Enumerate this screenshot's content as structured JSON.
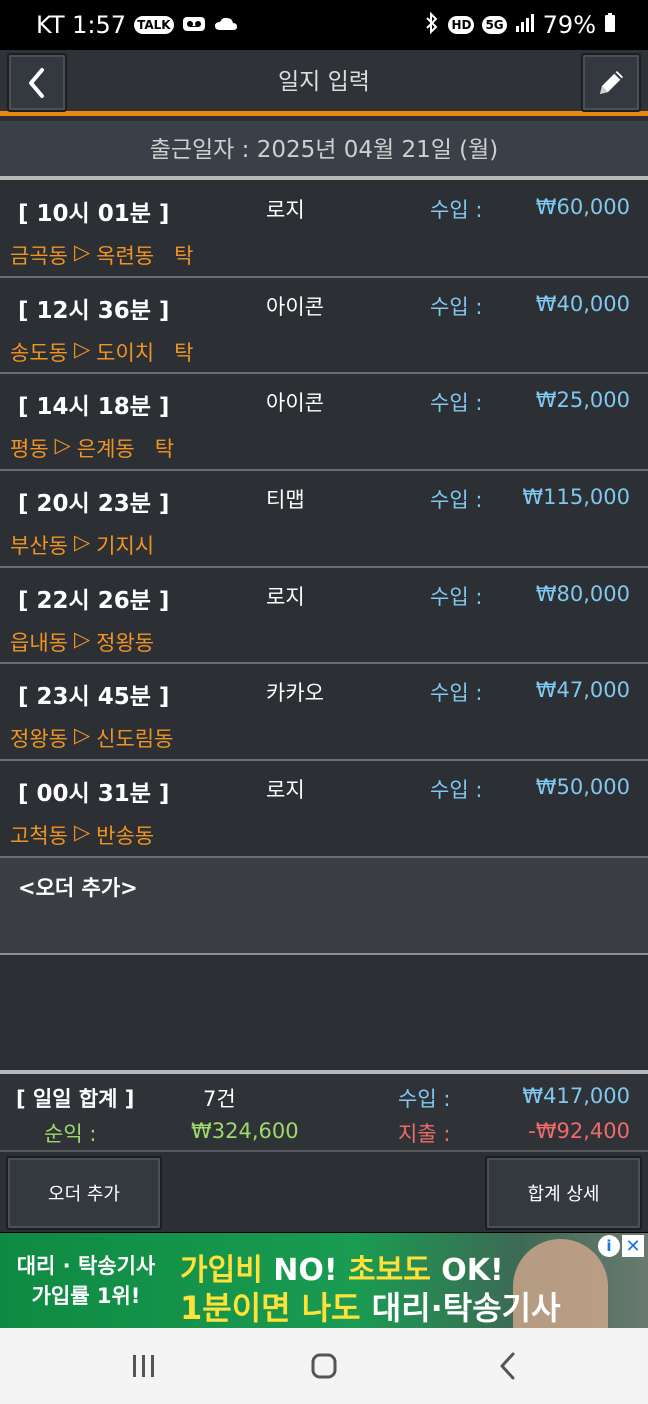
{
  "status_bar": {
    "carrier_time": "KT 1:57",
    "talk_badge": "TALK",
    "hd_badge": "HD",
    "net_badge": "5G",
    "battery": "79%"
  },
  "header": {
    "title": "일지 입력"
  },
  "date_bar": {
    "text": "출근일자 : 2025년 04월 21일 (월)"
  },
  "orders": [
    {
      "time": "[ 10시 01분 ]",
      "company": "로지",
      "income_label": "수입 :",
      "amount": "₩60,000",
      "from": "금곡동",
      "to": "옥련동",
      "tag": "탁"
    },
    {
      "time": "[ 12시 36분 ]",
      "company": "아이콘",
      "income_label": "수입 :",
      "amount": "₩40,000",
      "from": "송도동",
      "to": "도이치",
      "tag": "탁"
    },
    {
      "time": "[ 14시 18분 ]",
      "company": "아이콘",
      "income_label": "수입 :",
      "amount": "₩25,000",
      "from": "평동",
      "to": "은계동",
      "tag": "탁"
    },
    {
      "time": "[ 20시 23분 ]",
      "company": "티맵",
      "income_label": "수입 :",
      "amount": "₩115,000",
      "from": "부산동",
      "to": "기지시",
      "tag": ""
    },
    {
      "time": "[ 22시 26분 ]",
      "company": "로지",
      "income_label": "수입 :",
      "amount": "₩80,000",
      "from": "읍내동",
      "to": "정왕동",
      "tag": ""
    },
    {
      "time": "[ 23시 45분 ]",
      "company": "카카오",
      "income_label": "수입 :",
      "amount": "₩47,000",
      "from": "정왕동",
      "to": "신도림동",
      "tag": ""
    },
    {
      "time": "[ 00시 31분 ]",
      "company": "로지",
      "income_label": "수입 :",
      "amount": "₩50,000",
      "from": "고척동",
      "to": "반송동",
      "tag": ""
    }
  ],
  "route_arrow": "▷",
  "add_order_row": "<오더 추가>",
  "summary": {
    "title": "[ 일일 합계 ]",
    "count": "7건",
    "income_label": "수입 :",
    "income_value": "₩417,000",
    "net_label": "순익 :",
    "net_value": "₩324,600",
    "expense_label": "지출 :",
    "expense_value": "-₩92,400"
  },
  "buttons": {
    "add_order": "오더 추가",
    "total_detail": "합계 상세"
  },
  "ad": {
    "left_line1": "대리 · 탁송기사",
    "left_line2": "가입률 1위!",
    "line1_a": "가입비 ",
    "line1_b": "NO! ",
    "line1_c": "초보도 ",
    "line1_d": "OK!",
    "line2_a": "1분이면 나도 ",
    "line2_b": "대리·탁송기사",
    "info": "i",
    "close": "✕"
  },
  "colors": {
    "accent_orange": "#e88a12",
    "route_orange": "#ef9422",
    "income_blue": "#7fc8f0",
    "net_green": "#9fd86a",
    "expense_red": "#f06a6a",
    "background": "#2c2f33"
  }
}
